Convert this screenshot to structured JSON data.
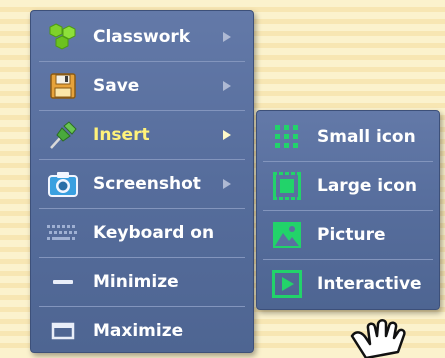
{
  "menu": {
    "items": [
      {
        "label": "Classwork",
        "icon": "classwork-icon",
        "has_submenu": true
      },
      {
        "label": "Save",
        "icon": "save-floppy-icon",
        "has_submenu": true
      },
      {
        "label": "Insert",
        "icon": "pushpin-icon",
        "has_submenu": true,
        "active": true
      },
      {
        "label": "Screenshot",
        "icon": "camera-icon",
        "has_submenu": true
      },
      {
        "label": "Keyboard on",
        "icon": "keyboard-icon",
        "has_submenu": false
      },
      {
        "label": "Minimize",
        "icon": "minimize-icon",
        "has_submenu": false
      },
      {
        "label": "Maximize",
        "icon": "maximize-icon",
        "has_submenu": false
      }
    ]
  },
  "submenu": {
    "items": [
      {
        "label": "Small icon",
        "icon": "small-icon-grid-icon"
      },
      {
        "label": "Large icon",
        "icon": "large-icon-frame-icon"
      },
      {
        "label": "Picture",
        "icon": "picture-icon"
      },
      {
        "label": "Interactive",
        "icon": "interactive-play-icon"
      }
    ]
  },
  "colors": {
    "menu_bg": "#5a70a0",
    "active_label": "#fff27a",
    "icon_green": "#22d36a",
    "background_stripe_light": "#fbf2cd",
    "background_stripe_dark": "#f7e6b3"
  }
}
